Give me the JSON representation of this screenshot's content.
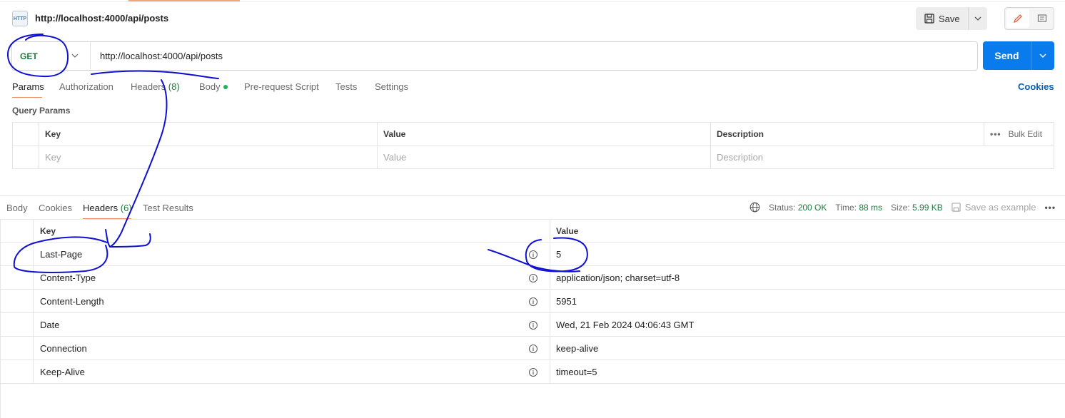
{
  "request": {
    "title": "http://localhost:4000/api/posts",
    "http_icon_text": "HTTP",
    "save_label": "Save",
    "method": "GET",
    "url": "http://localhost:4000/api/posts",
    "send_label": "Send"
  },
  "request_tabs": {
    "params": "Params",
    "authorization": "Authorization",
    "headers": "Headers",
    "headers_count": "(8)",
    "body": "Body",
    "pre_request": "Pre-request Script",
    "tests": "Tests",
    "settings": "Settings",
    "cookies": "Cookies"
  },
  "query_params": {
    "label": "Query Params",
    "columns": {
      "key": "Key",
      "value": "Value",
      "description": "Description",
      "bulk_edit": "Bulk Edit"
    },
    "placeholders": {
      "key": "Key",
      "value": "Value",
      "description": "Description"
    }
  },
  "response_tabs": {
    "body": "Body",
    "cookies": "Cookies",
    "headers": "Headers",
    "headers_count": "(6)",
    "test_results": "Test Results"
  },
  "response_meta": {
    "status_label": "Status:",
    "status_value": "200 OK",
    "time_label": "Time:",
    "time_value": "88 ms",
    "size_label": "Size:",
    "size_value": "5.99 KB",
    "save_example": "Save as example"
  },
  "response_headers": {
    "columns": {
      "key": "Key",
      "value": "Value"
    },
    "rows": [
      {
        "key": "Last-Page",
        "value": "5"
      },
      {
        "key": "Content-Type",
        "value": "application/json; charset=utf-8"
      },
      {
        "key": "Content-Length",
        "value": "5951"
      },
      {
        "key": "Date",
        "value": "Wed, 21 Feb 2024 04:06:43 GMT"
      },
      {
        "key": "Connection",
        "value": "keep-alive"
      },
      {
        "key": "Keep-Alive",
        "value": "timeout=5"
      }
    ]
  },
  "colors": {
    "accent_orange": "#f08a5d",
    "send_blue": "#097bed",
    "success_green": "#1e7a3c",
    "annotation_ink": "#1010d0"
  },
  "icons": [
    "http-icon",
    "save-icon",
    "chevron-down-icon",
    "pencil-icon",
    "comment-icon",
    "globe-icon",
    "more-icon",
    "info-icon"
  ]
}
